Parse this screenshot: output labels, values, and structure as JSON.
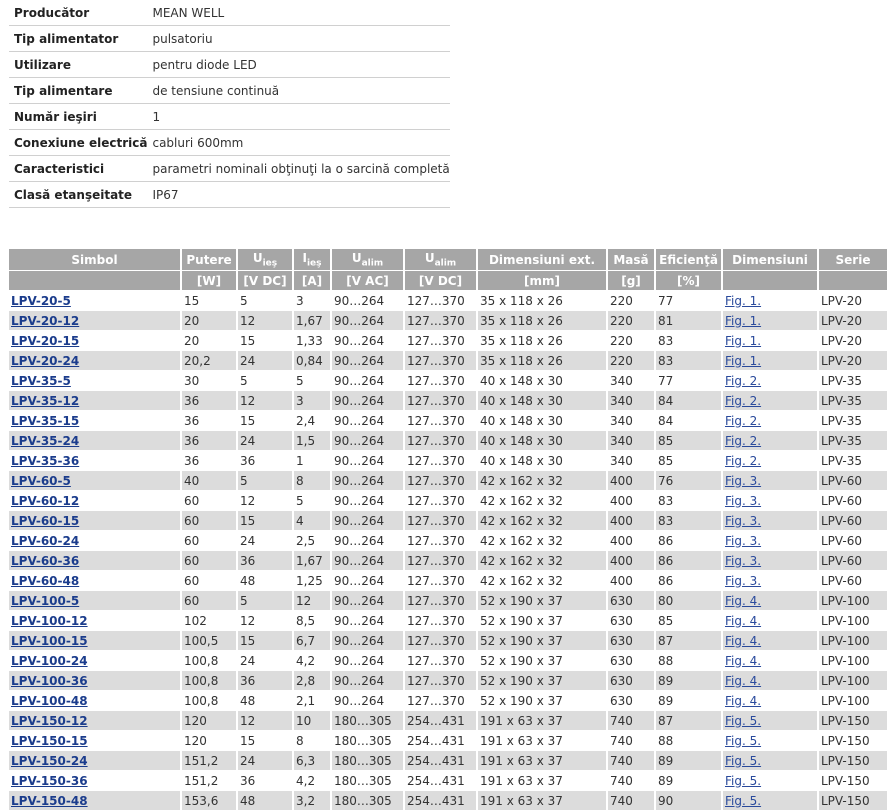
{
  "properties": [
    {
      "label": "Producător",
      "value": "MEAN WELL"
    },
    {
      "label": "Tip alimentator",
      "value": "pulsatoriu"
    },
    {
      "label": "Utilizare",
      "value": "pentru diode LED"
    },
    {
      "label": "Tip alimentare",
      "value": "de tensiune continuă"
    },
    {
      "label": "Număr ieşiri",
      "value": "1"
    },
    {
      "label": "Conexiune electrică",
      "value": "cabluri 600mm"
    },
    {
      "label": "Caracteristici",
      "value": "parametri nominali obţinuţi la o sarcină completă"
    },
    {
      "label": "Clasă etanşeitate",
      "value": "IP67"
    }
  ],
  "table": {
    "headers": [
      {
        "main": "Simbol",
        "sub": "",
        "unit": ""
      },
      {
        "main": "Putere",
        "sub": "",
        "unit": "[W]"
      },
      {
        "main": "U",
        "sub": "ieş",
        "unit": "[V DC]"
      },
      {
        "main": "I",
        "sub": "ieş",
        "unit": "[A]"
      },
      {
        "main": "U",
        "sub": "alim",
        "unit": "[V AC]"
      },
      {
        "main": "U",
        "sub": "alim",
        "unit": "[V DC]"
      },
      {
        "main": "Dimensiuni ext.",
        "sub": "",
        "unit": "[mm]"
      },
      {
        "main": "Masă",
        "sub": "",
        "unit": "[g]"
      },
      {
        "main": "Eficienţă",
        "sub": "",
        "unit": "[%]"
      },
      {
        "main": "Dimensiuni",
        "sub": "",
        "unit": ""
      },
      {
        "main": "Serie",
        "sub": "",
        "unit": ""
      }
    ],
    "rows": [
      [
        "LPV-20-5",
        "15",
        "5",
        "3",
        "90…264",
        "127…370",
        "35 x 118 x 26",
        "220",
        "77",
        "Fig. 1.",
        "LPV-20"
      ],
      [
        "LPV-20-12",
        "20",
        "12",
        "1,67",
        "90…264",
        "127…370",
        "35 x 118 x 26",
        "220",
        "81",
        "Fig. 1.",
        "LPV-20"
      ],
      [
        "LPV-20-15",
        "20",
        "15",
        "1,33",
        "90…264",
        "127…370",
        "35 x 118 x 26",
        "220",
        "83",
        "Fig. 1.",
        "LPV-20"
      ],
      [
        "LPV-20-24",
        "20,2",
        "24",
        "0,84",
        "90…264",
        "127…370",
        "35 x 118 x 26",
        "220",
        "83",
        "Fig. 1.",
        "LPV-20"
      ],
      [
        "LPV-35-5",
        "30",
        "5",
        "5",
        "90…264",
        "127…370",
        "40 x 148 x 30",
        "340",
        "77",
        "Fig. 2.",
        "LPV-35"
      ],
      [
        "LPV-35-12",
        "36",
        "12",
        "3",
        "90…264",
        "127…370",
        "40 x 148 x 30",
        "340",
        "84",
        "Fig. 2.",
        "LPV-35"
      ],
      [
        "LPV-35-15",
        "36",
        "15",
        "2,4",
        "90…264",
        "127…370",
        "40 x 148 x 30",
        "340",
        "84",
        "Fig. 2.",
        "LPV-35"
      ],
      [
        "LPV-35-24",
        "36",
        "24",
        "1,5",
        "90…264",
        "127…370",
        "40 x 148 x 30",
        "340",
        "85",
        "Fig. 2.",
        "LPV-35"
      ],
      [
        "LPV-35-36",
        "36",
        "36",
        "1",
        "90…264",
        "127…370",
        "40 x 148 x 30",
        "340",
        "85",
        "Fig. 2.",
        "LPV-35"
      ],
      [
        "LPV-60-5",
        "40",
        "5",
        "8",
        "90…264",
        "127…370",
        "42 x 162 x 32",
        "400",
        "76",
        "Fig. 3.",
        "LPV-60"
      ],
      [
        "LPV-60-12",
        "60",
        "12",
        "5",
        "90…264",
        "127…370",
        "42 x 162 x 32",
        "400",
        "83",
        "Fig. 3.",
        "LPV-60"
      ],
      [
        "LPV-60-15",
        "60",
        "15",
        "4",
        "90…264",
        "127…370",
        "42 x 162 x 32",
        "400",
        "83",
        "Fig. 3.",
        "LPV-60"
      ],
      [
        "LPV-60-24",
        "60",
        "24",
        "2,5",
        "90…264",
        "127…370",
        "42 x 162 x 32",
        "400",
        "86",
        "Fig. 3.",
        "LPV-60"
      ],
      [
        "LPV-60-36",
        "60",
        "36",
        "1,67",
        "90…264",
        "127…370",
        "42 x 162 x 32",
        "400",
        "86",
        "Fig. 3.",
        "LPV-60"
      ],
      [
        "LPV-60-48",
        "60",
        "48",
        "1,25",
        "90…264",
        "127…370",
        "42 x 162 x 32",
        "400",
        "86",
        "Fig. 3.",
        "LPV-60"
      ],
      [
        "LPV-100-5",
        "60",
        "5",
        "12",
        "90…264",
        "127…370",
        "52 x 190 x 37",
        "630",
        "80",
        "Fig. 4.",
        "LPV-100"
      ],
      [
        "LPV-100-12",
        "102",
        "12",
        "8,5",
        "90…264",
        "127…370",
        "52 x 190 x 37",
        "630",
        "85",
        "Fig. 4.",
        "LPV-100"
      ],
      [
        "LPV-100-15",
        "100,5",
        "15",
        "6,7",
        "90…264",
        "127…370",
        "52 x 190 x 37",
        "630",
        "87",
        "Fig. 4.",
        "LPV-100"
      ],
      [
        "LPV-100-24",
        "100,8",
        "24",
        "4,2",
        "90…264",
        "127…370",
        "52 x 190 x 37",
        "630",
        "88",
        "Fig. 4.",
        "LPV-100"
      ],
      [
        "LPV-100-36",
        "100,8",
        "36",
        "2,8",
        "90…264",
        "127…370",
        "52 x 190 x 37",
        "630",
        "89",
        "Fig. 4.",
        "LPV-100"
      ],
      [
        "LPV-100-48",
        "100,8",
        "48",
        "2,1",
        "90…264",
        "127…370",
        "52 x 190 x 37",
        "630",
        "89",
        "Fig. 4.",
        "LPV-100"
      ],
      [
        "LPV-150-12",
        "120",
        "12",
        "10",
        "180…305",
        "254…431",
        "191 x 63 x 37",
        "740",
        "87",
        "Fig. 5.",
        "LPV-150"
      ],
      [
        "LPV-150-15",
        "120",
        "15",
        "8",
        "180…305",
        "254…431",
        "191 x 63 x 37",
        "740",
        "88",
        "Fig. 5.",
        "LPV-150"
      ],
      [
        "LPV-150-24",
        "151,2",
        "24",
        "6,3",
        "180…305",
        "254…431",
        "191 x 63 x 37",
        "740",
        "89",
        "Fig. 5.",
        "LPV-150"
      ],
      [
        "LPV-150-36",
        "151,2",
        "36",
        "4,2",
        "180…305",
        "254…431",
        "191 x 63 x 37",
        "740",
        "89",
        "Fig. 5.",
        "LPV-150"
      ],
      [
        "LPV-150-48",
        "153,6",
        "48",
        "3,2",
        "180…305",
        "254…431",
        "191 x 63 x 37",
        "740",
        "90",
        "Fig. 5.",
        "LPV-150"
      ]
    ]
  }
}
